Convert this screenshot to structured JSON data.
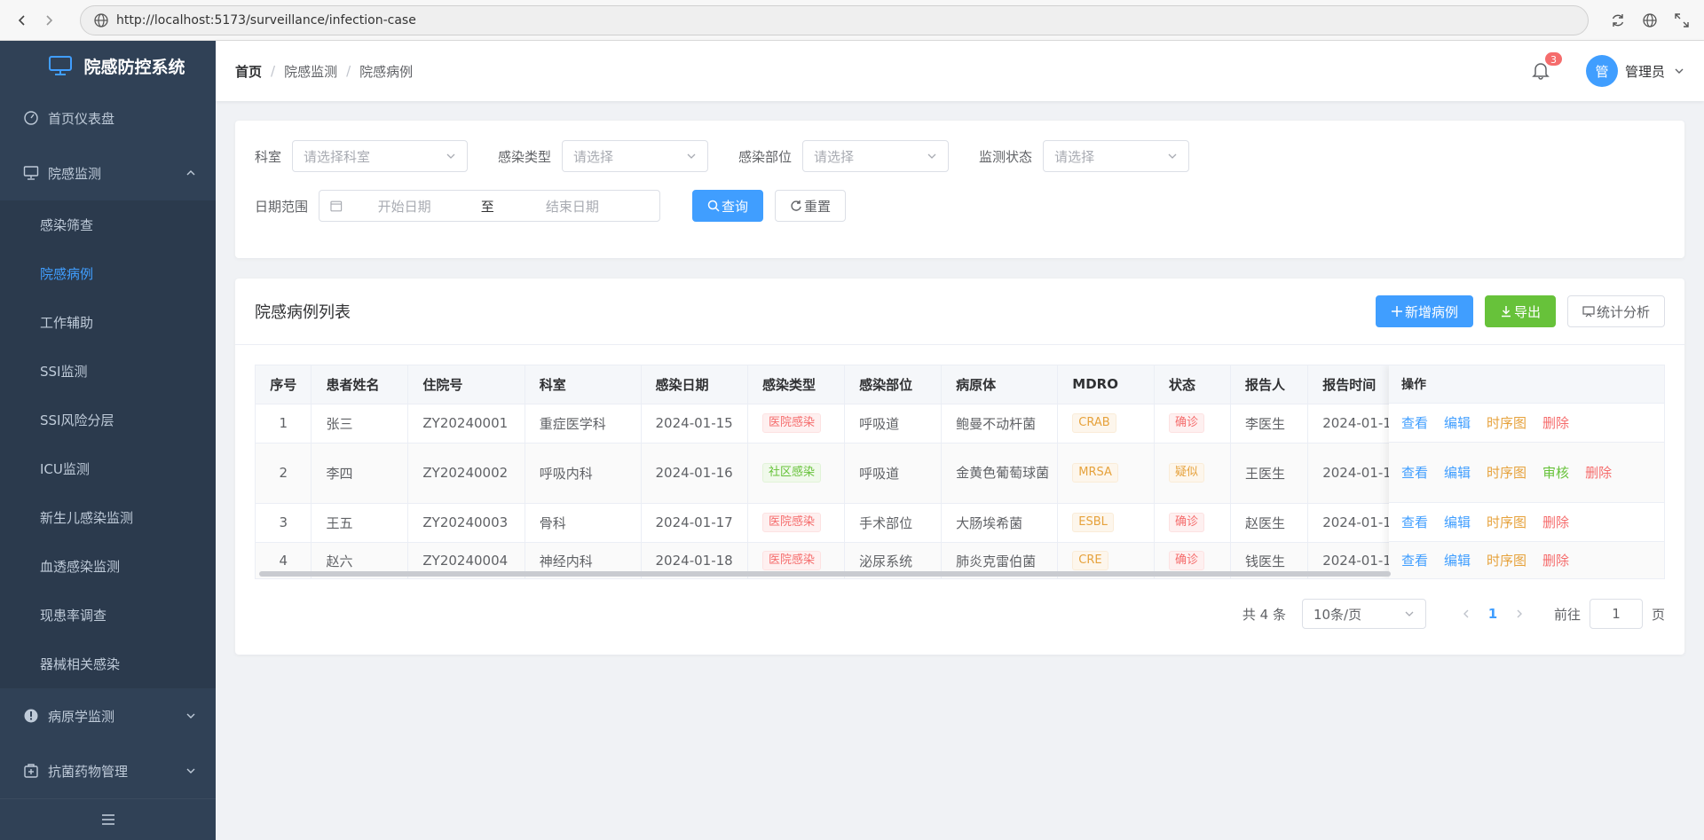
{
  "browser": {
    "url": "http://localhost:5173/surveillance/infection-case"
  },
  "app": {
    "title": "院感防控系统"
  },
  "sidebar": {
    "items": [
      {
        "label": "首页仪表盘"
      },
      {
        "label": "院感监测"
      },
      {
        "label": "病原学监测"
      },
      {
        "label": "抗菌药物管理"
      }
    ],
    "subitems": [
      {
        "label": "感染筛查"
      },
      {
        "label": "院感病例"
      },
      {
        "label": "工作辅助"
      },
      {
        "label": "SSI监测"
      },
      {
        "label": "SSI风险分层"
      },
      {
        "label": "ICU监测"
      },
      {
        "label": "新生儿感染监测"
      },
      {
        "label": "血透感染监测"
      },
      {
        "label": "现患率调查"
      },
      {
        "label": "器械相关感染"
      }
    ]
  },
  "breadcrumb": [
    "首页",
    "院感监测",
    "院感病例"
  ],
  "header": {
    "notification_count": "3",
    "avatar_text": "管",
    "user_name": "管理员"
  },
  "filters": {
    "dept_label": "科室",
    "dept_placeholder": "请选择科室",
    "type_label": "感染类型",
    "type_placeholder": "请选择",
    "site_label": "感染部位",
    "site_placeholder": "请选择",
    "status_label": "监测状态",
    "status_placeholder": "请选择",
    "date_label": "日期范围",
    "start_placeholder": "开始日期",
    "to": "至",
    "end_placeholder": "结束日期",
    "query_button": "查询",
    "reset_button": "重置"
  },
  "list": {
    "title": "院感病例列表",
    "add_button": "新增病例",
    "export_button": "导出",
    "stats_button": "统计分析",
    "columns": [
      "序号",
      "患者姓名",
      "住院号",
      "科室",
      "感染日期",
      "感染类型",
      "感染部位",
      "病原体",
      "MDRO",
      "状态",
      "报告人",
      "报告时间",
      "操作"
    ],
    "rows": [
      {
        "index": "1",
        "name": "张三",
        "admission_no": "ZY20240001",
        "dept": "重症医学科",
        "date": "2024-01-15",
        "type": "医院感染",
        "site": "呼吸道",
        "pathogen": "鲍曼不动杆菌",
        "mdro": "CRAB",
        "status": "确诊",
        "reporter": "李医生",
        "report_time": "2024-01-1",
        "actions": [
          "查看",
          "编辑",
          "时序图",
          "删除"
        ]
      },
      {
        "index": "2",
        "name": "李四",
        "admission_no": "ZY20240002",
        "dept": "呼吸内科",
        "date": "2024-01-16",
        "type": "社区感染",
        "site": "呼吸道",
        "pathogen": "金黄色葡萄球菌",
        "mdro": "MRSA",
        "status": "疑似",
        "reporter": "王医生",
        "report_time": "2024-01-1",
        "actions": [
          "查看",
          "编辑",
          "时序图",
          "审核",
          "删除"
        ]
      },
      {
        "index": "3",
        "name": "王五",
        "admission_no": "ZY20240003",
        "dept": "骨科",
        "date": "2024-01-17",
        "type": "医院感染",
        "site": "手术部位",
        "pathogen": "大肠埃希菌",
        "mdro": "ESBL",
        "status": "确诊",
        "reporter": "赵医生",
        "report_time": "2024-01-1",
        "actions": [
          "查看",
          "编辑",
          "时序图",
          "删除"
        ]
      },
      {
        "index": "4",
        "name": "赵六",
        "admission_no": "ZY20240004",
        "dept": "神经内科",
        "date": "2024-01-18",
        "type": "医院感染",
        "site": "泌尿系统",
        "pathogen": "肺炎克雷伯菌",
        "mdro": "CRE",
        "status": "确诊",
        "reporter": "钱医生",
        "report_time": "2024-01-1",
        "actions": [
          "查看",
          "编辑",
          "时序图",
          "删除"
        ]
      }
    ]
  },
  "pagination": {
    "total": "共 4 条",
    "page_size": "10条/页",
    "current_page": "1",
    "goto_label": "前往",
    "goto_value": "1",
    "page_suffix": "页"
  },
  "colors": {
    "sidebar_bg": "#304156",
    "primary": "#409eff",
    "success": "#67c23a",
    "warning": "#e6a23c",
    "danger": "#f56c6c"
  }
}
